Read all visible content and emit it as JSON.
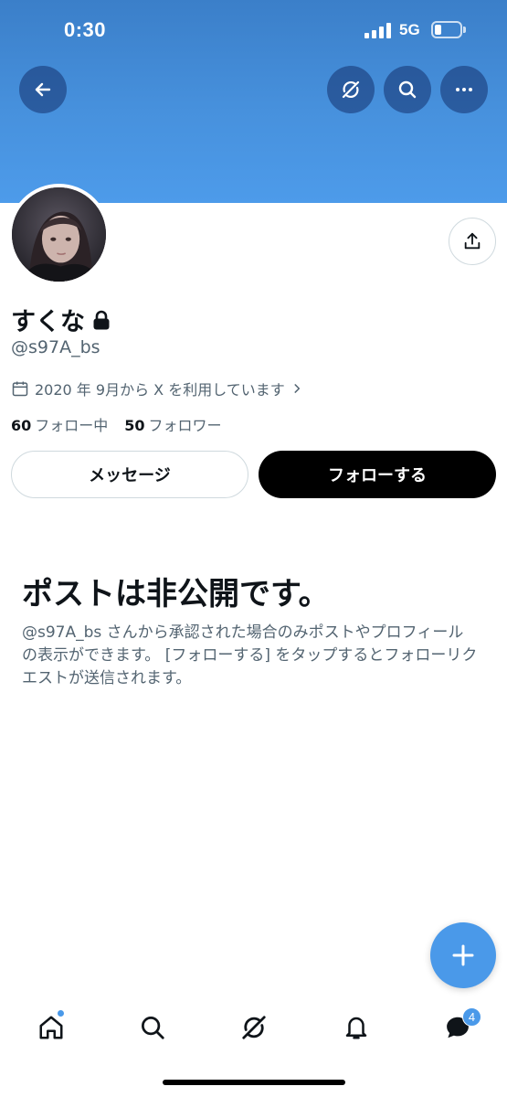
{
  "status_bar": {
    "time": "0:30",
    "network": "5G",
    "battery_level": 0.25,
    "signal_bars": 4
  },
  "header": {
    "back_icon": "arrow-left-icon",
    "grok_icon": "grok-icon",
    "search_icon": "search-icon",
    "more_icon": "more-horizontal-icon"
  },
  "profile": {
    "display_name": "すくな",
    "handle": "@s97A_bs",
    "joined": "2020 年 9月から X を利用しています",
    "following_count": "60",
    "following_label": "フォロー中",
    "followers_count": "50",
    "followers_label": "フォロワー"
  },
  "actions": {
    "message_label": "メッセージ",
    "follow_label": "フォローする"
  },
  "private_notice": {
    "title": "ポストは非公開です。",
    "description": "@s97A_bs さんから承認された場合のみポストやプロフィールの表示ができます。 [フォローする] をタップするとフォローリクエストが送信されます。"
  },
  "bottom_nav": {
    "items": [
      "home-icon",
      "search-icon",
      "grok-icon",
      "bell-icon",
      "messages-icon"
    ],
    "messages_badge": "4"
  },
  "colors": {
    "banner": "#4791dd",
    "accent": "#4a99e9",
    "follow_button": "#000000",
    "secondary_text": "#536471"
  }
}
